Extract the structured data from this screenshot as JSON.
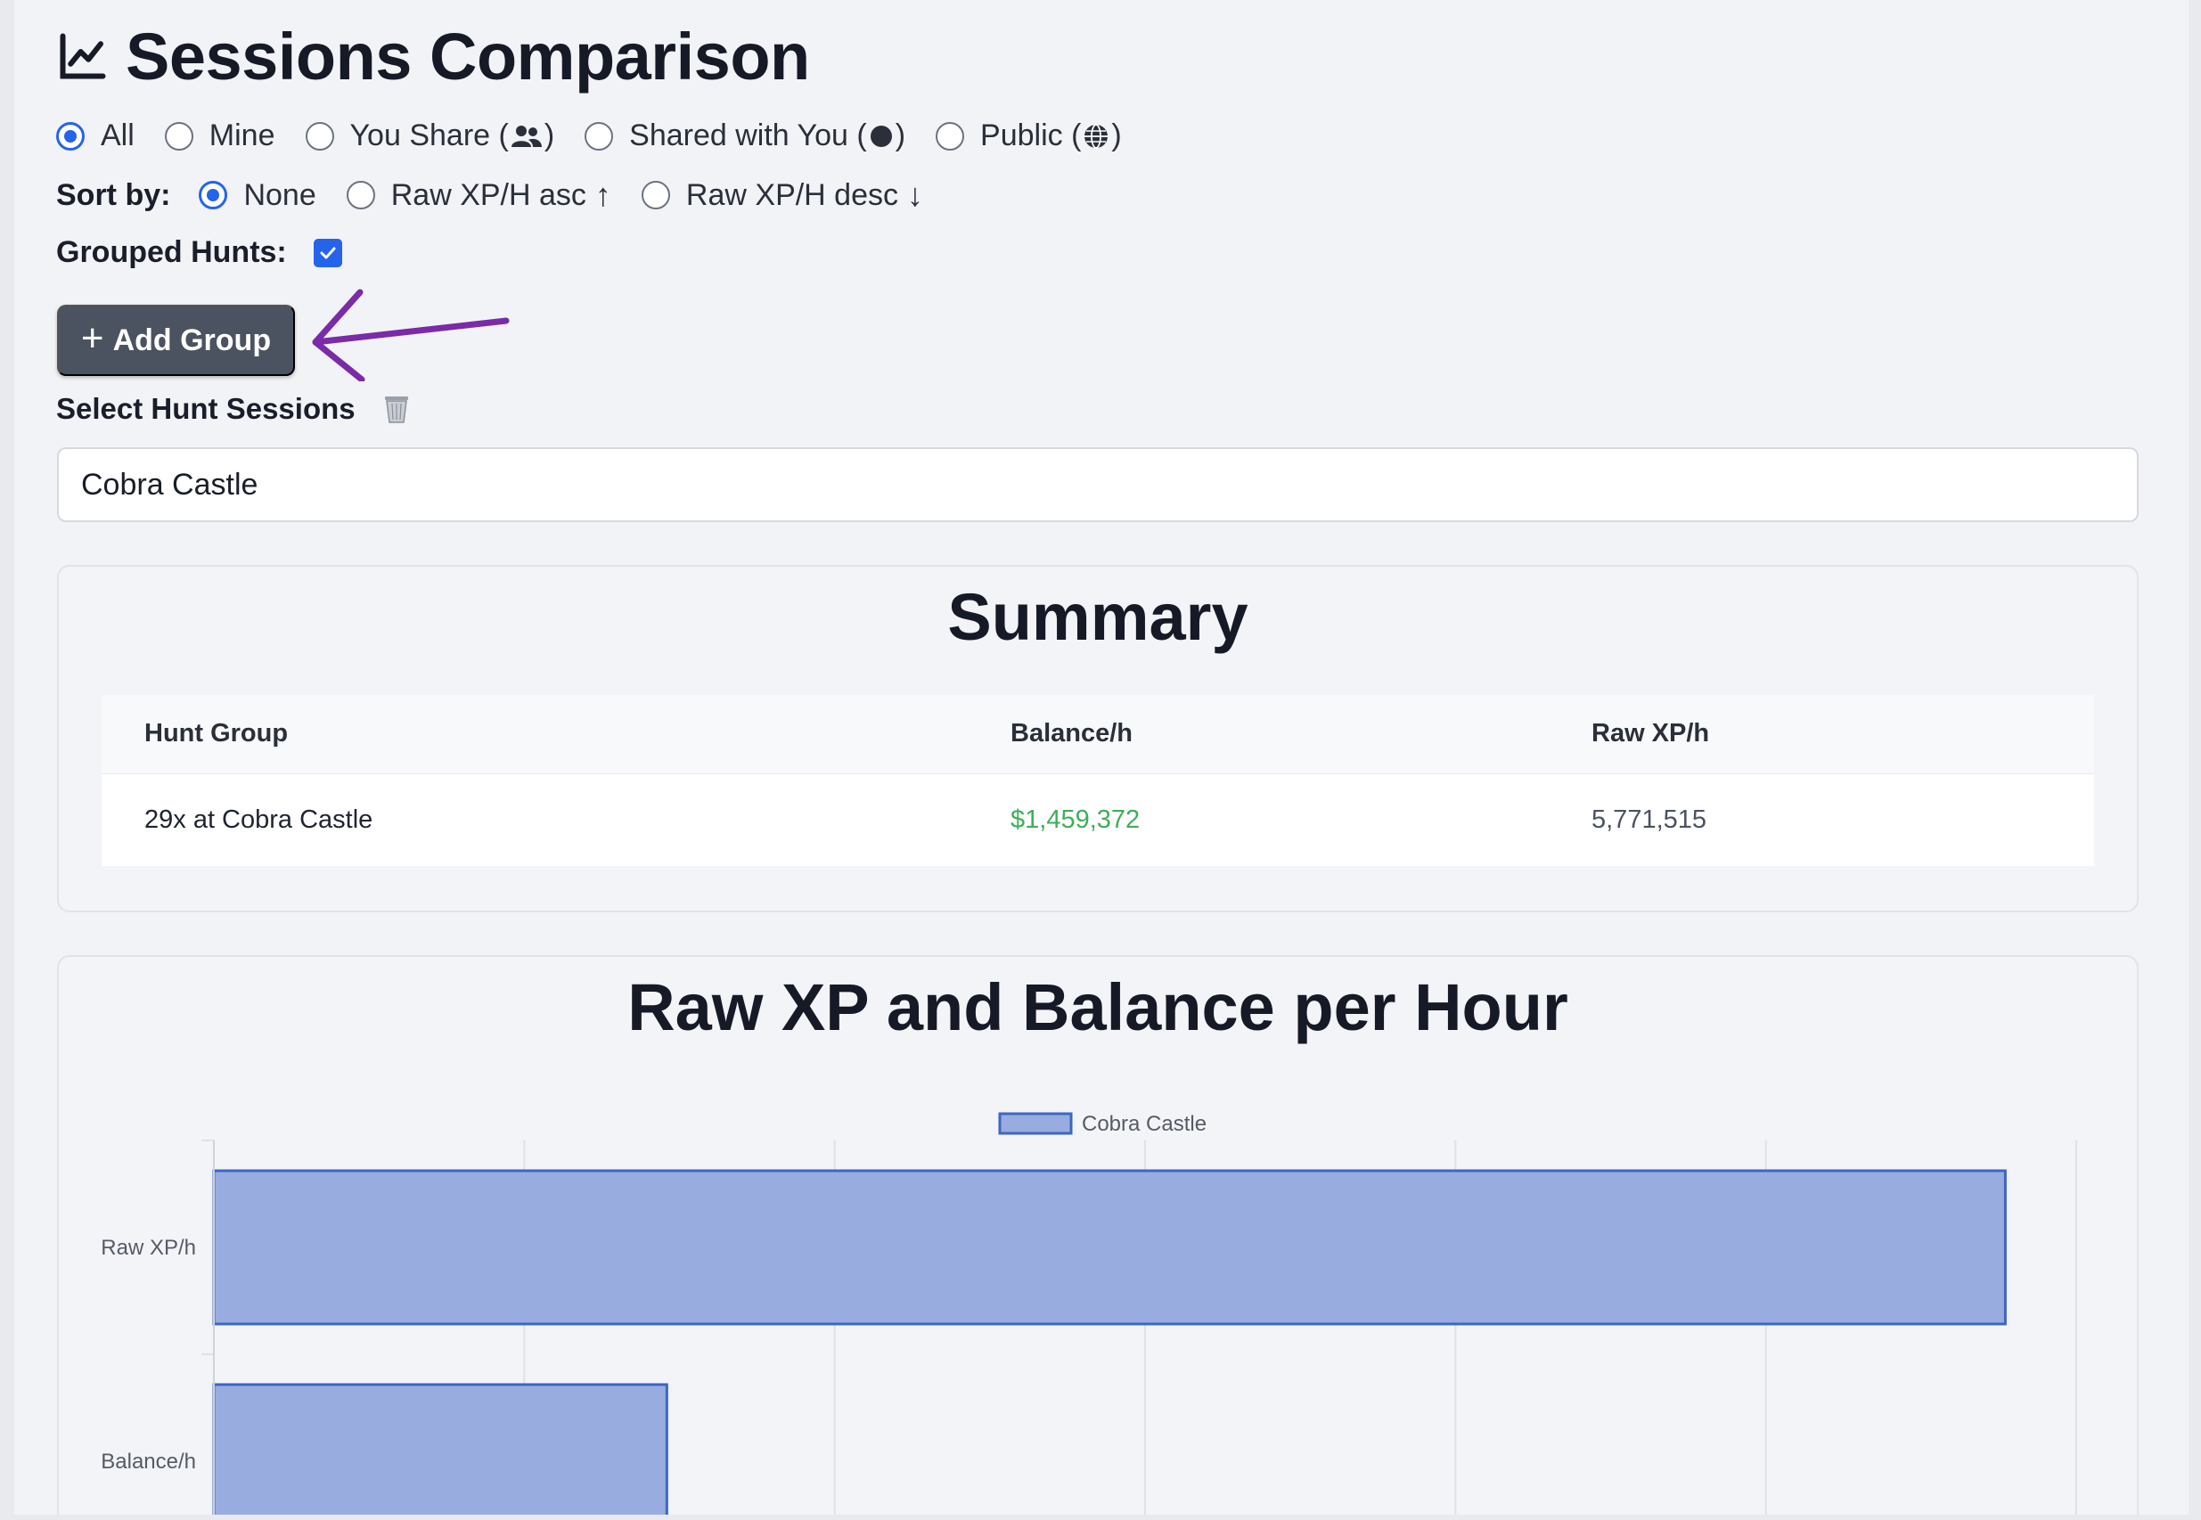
{
  "header": {
    "title": "Sessions Comparison",
    "icon": "chart-line-icon"
  },
  "filters": {
    "selected": "All",
    "options": [
      {
        "label": "All",
        "checked": true
      },
      {
        "label": "Mine",
        "checked": false
      },
      {
        "label": "You Share (",
        "suffix": ")",
        "icon": "users-icon",
        "checked": false
      },
      {
        "label": "Shared with You (",
        "suffix": ")",
        "icon": "circle-icon",
        "checked": false
      },
      {
        "label": "Public (",
        "suffix": ")",
        "icon": "globe-icon",
        "checked": false
      }
    ]
  },
  "sort": {
    "label": "Sort by:",
    "options": [
      {
        "label": "None",
        "checked": true
      },
      {
        "label": "Raw XP/H asc",
        "arrow": "↑",
        "checked": false
      },
      {
        "label": "Raw XP/H desc",
        "arrow": "↓",
        "checked": false
      }
    ]
  },
  "grouped": {
    "label": "Grouped Hunts:",
    "checked": true
  },
  "add_group": {
    "plus": "+",
    "label": "Add Group"
  },
  "select_sessions": {
    "label": "Select Hunt Sessions",
    "value": "Cobra Castle",
    "trash_icon": "trash-icon"
  },
  "summary": {
    "title": "Summary",
    "headers": [
      "Hunt Group",
      "Balance/h",
      "Raw XP/h"
    ],
    "rows": [
      {
        "group": "29x at Cobra Castle",
        "balance": "$1,459,372",
        "raw_xp": "5,771,515"
      }
    ]
  },
  "chart": {
    "title": "Raw XP and Balance per Hour"
  },
  "chart_data": {
    "type": "bar",
    "orientation": "horizontal",
    "categories": [
      "Raw XP/h",
      "Balance/h"
    ],
    "series": [
      {
        "name": "Cobra Castle",
        "values": [
          5771515,
          1459372
        ]
      }
    ],
    "xlim": [
      0,
      6000000
    ],
    "grid": true,
    "legend": "top-center",
    "colors": {
      "fill": "#99acdf",
      "stroke": "#3d66c4"
    }
  },
  "colors": {
    "accent": "#2563eb",
    "button": "#4b5260",
    "money": "#3fae5a",
    "annotation": "#7b2aa8"
  }
}
